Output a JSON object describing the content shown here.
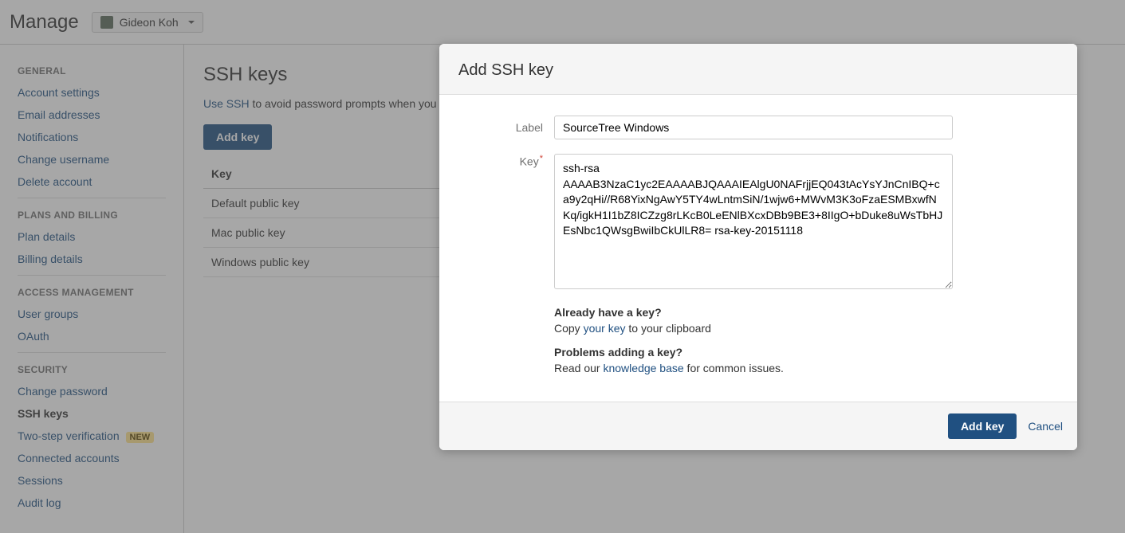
{
  "header": {
    "title": "Manage",
    "user_name": "Gideon Koh"
  },
  "sidebar": {
    "general": {
      "title": "GENERAL",
      "items": [
        "Account settings",
        "Email addresses",
        "Notifications",
        "Change username",
        "Delete account"
      ]
    },
    "plans": {
      "title": "PLANS AND BILLING",
      "items": [
        "Plan details",
        "Billing details"
      ]
    },
    "access": {
      "title": "ACCESS MANAGEMENT",
      "items": [
        "User groups",
        "OAuth"
      ]
    },
    "security": {
      "title": "SECURITY",
      "items": [
        "Change password",
        "SSH keys",
        "Two-step verification",
        "Connected accounts",
        "Sessions",
        "Audit log"
      ],
      "new_badge": "NEW"
    }
  },
  "main": {
    "title": "SSH keys",
    "intro_link": "Use SSH",
    "intro_rest": " to avoid password prompts when you",
    "add_key_button": "Add key",
    "table": {
      "header": "Key",
      "rows": [
        "Default public key",
        "Mac public key",
        "Windows public key"
      ]
    }
  },
  "modal": {
    "title": "Add SSH key",
    "label_field": "Label",
    "label_value": "SourceTree Windows",
    "key_field": "Key",
    "key_value": "ssh-rsa AAAAB3NzaC1yc2EAAAABJQAAAIEAlgU0NAFrjjEQ043tAcYsYJnCnIBQ+ca9y2qHi//R68YixNgAwY5TY4wLntmSiN/1wjw6+MWvM3K3oFzaESMBxwfNKq/igkH1I1bZ8ICZzg8rLKcB0LeENlBXcxDBb9BE3+8IIgO+bDuke8uWsTbHJEsNbc1QWsgBwiIbCkUlLR8= rsa-key-20151118",
    "help1_heading": "Already have a key?",
    "help1_pre": "Copy ",
    "help1_link": "your key",
    "help1_post": " to your clipboard",
    "help2_heading": "Problems adding a key?",
    "help2_pre": "Read our ",
    "help2_link": "knowledge base",
    "help2_post": " for common issues.",
    "add_button": "Add key",
    "cancel": "Cancel"
  }
}
